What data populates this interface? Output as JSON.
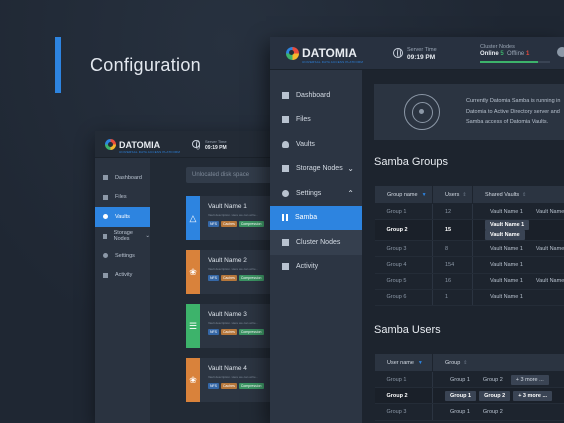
{
  "hero": {
    "title": "Configuration"
  },
  "back": {
    "logo": "DATOMIA",
    "logo_sub": "UNIVERSAL DATA ACCESS PLATFORM",
    "server_label": "Server Time",
    "server_time": "09:19 PM",
    "sidebar": [
      "Dashboard",
      "Files",
      "Vaults",
      "Storage Nodes",
      "Settings",
      "Activity"
    ],
    "search_placeholder": "Unlocated disk space",
    "vaults": [
      {
        "name": "Vault Name 1",
        "desc": "Vault description. Here we can write...",
        "icon": "△",
        "color": "#2d84e0"
      },
      {
        "name": "Vault Name 2",
        "desc": "Vault description. Here we can write...",
        "icon": "❀",
        "color": "#d9823b"
      },
      {
        "name": "Vault Name 3",
        "desc": "Vault description. Here we can write...",
        "icon": "☰",
        "color": "#3db36b"
      },
      {
        "name": "Vault Name 4",
        "desc": "Vault description. Here we can write...",
        "icon": "❀",
        "color": "#d9823b"
      }
    ],
    "tags": [
      "NFS",
      "Caches",
      "Compression"
    ]
  },
  "front": {
    "logo": "DATOMIA",
    "logo_sub": "UNIVERSAL DATA ACCESS PLATFORM",
    "server_label": "Server Time",
    "server_time": "09:19 PM",
    "cluster_label": "Cluster Nodes",
    "online": "Online",
    "online_count": "5",
    "offline": "Offline",
    "offline_count": "1",
    "cluster_online_fraction": 0.83,
    "sidebar": [
      "Dashboard",
      "Files",
      "Vaults",
      "Storage Nodes",
      "Settings",
      "Samba",
      "Cluster Nodes",
      "Activity"
    ],
    "info_lines": [
      "Currently Datomia Samba is running in",
      "Datomia to Active Directory server and",
      "Samba access of Datomia Vaults."
    ],
    "groups_title": "Samba Groups",
    "groups_cols": [
      "Group name",
      "Users",
      "Shared Vaults"
    ],
    "groups": [
      {
        "name": "Group 1",
        "users": "12",
        "v1": "Vault Name 1",
        "v2": "Vault Name"
      },
      {
        "name": "Group 2",
        "users": "15",
        "v1": "Vault Name 1",
        "v2": "Vault Name"
      },
      {
        "name": "Group 3",
        "users": "8",
        "v1": "Vault Name 1",
        "v2": "Vault Name"
      },
      {
        "name": "Group 4",
        "users": "154",
        "v1": "Vault Name 1",
        "v2": ""
      },
      {
        "name": "Group 5",
        "users": "16",
        "v1": "Vault Name 1",
        "v2": "Vault Name"
      },
      {
        "name": "Group 6",
        "users": "1",
        "v1": "Vault Name 1",
        "v2": ""
      }
    ],
    "users_title": "Samba Users",
    "users_cols": [
      "User name",
      "Group"
    ],
    "users": [
      {
        "name": "Group 1",
        "g1": "Group 1",
        "g2": "Group 2",
        "more": "+ 3 more ..."
      },
      {
        "name": "Group 2",
        "g1": "Group 1",
        "g2": "Group 2",
        "more": "+ 3 more ..."
      },
      {
        "name": "Group 3",
        "g1": "Group 1",
        "g2": "Group 2",
        "more": ""
      }
    ]
  }
}
